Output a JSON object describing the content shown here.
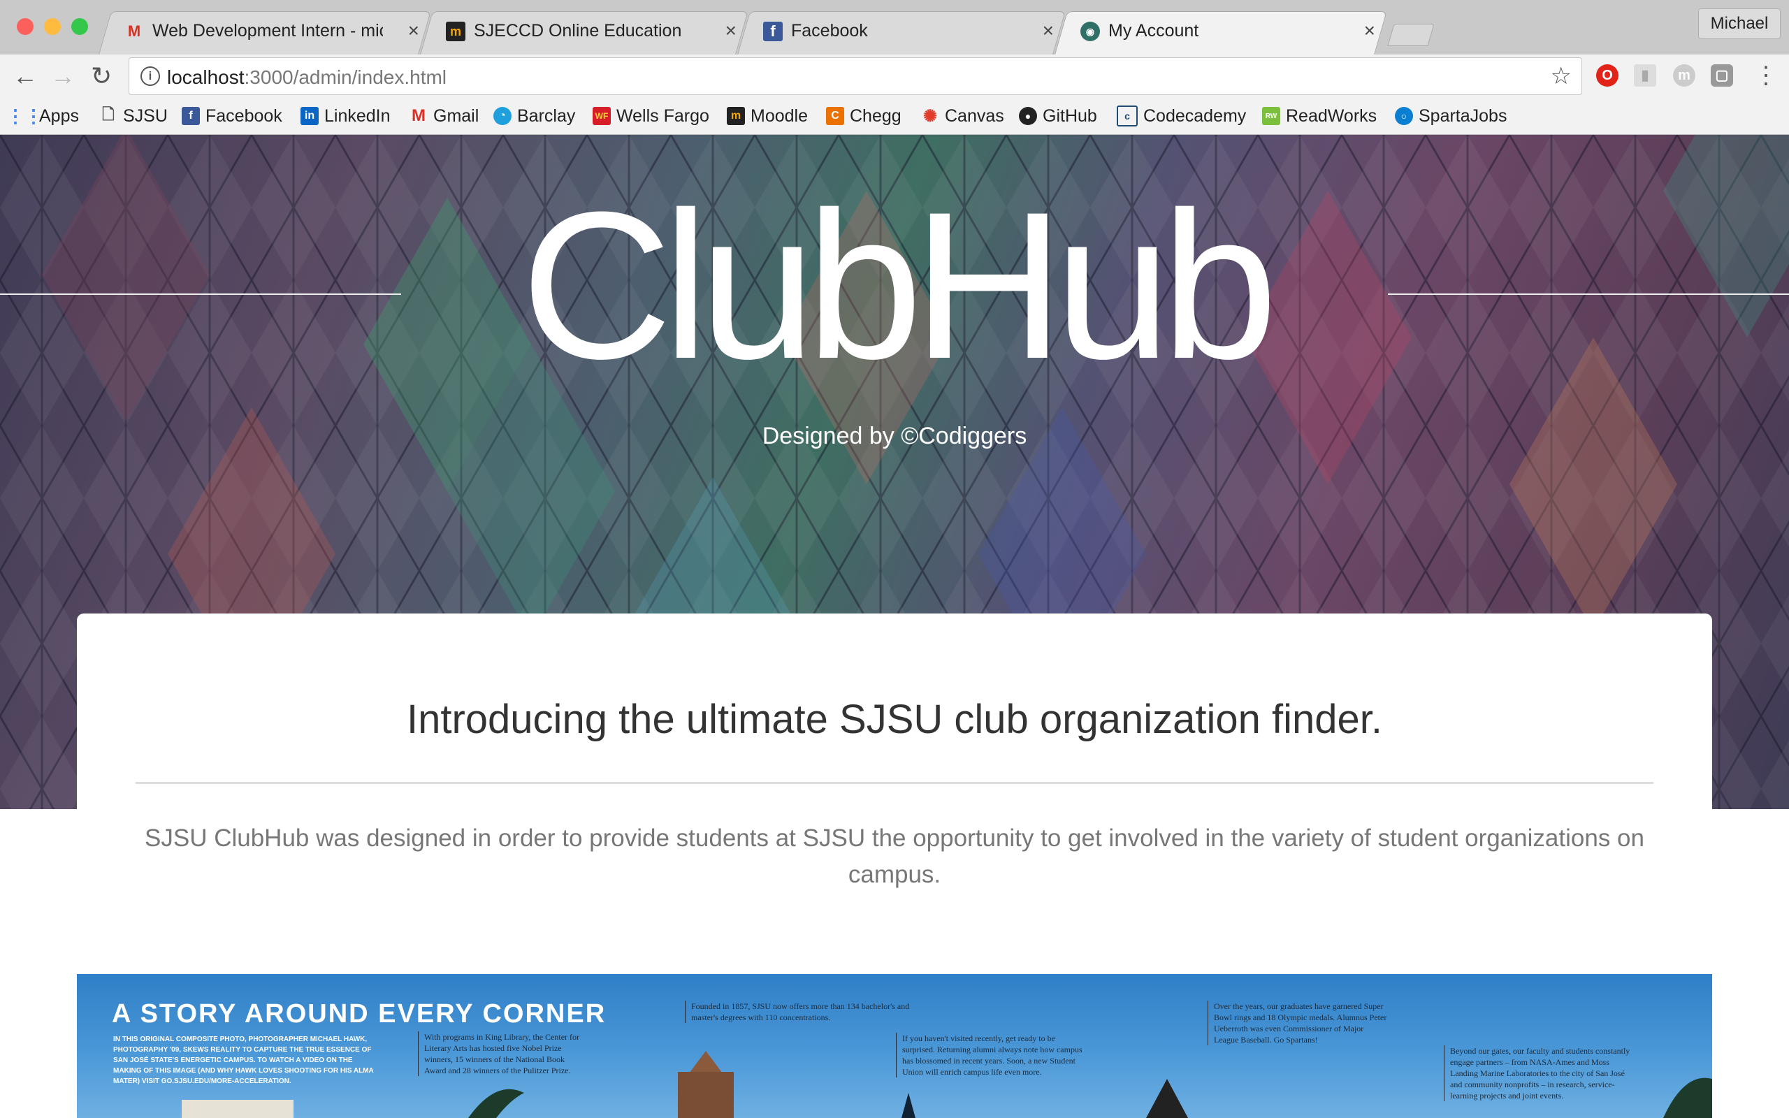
{
  "browser": {
    "tabs": [
      {
        "icon": "gmail-icon",
        "title": "Web Development Intern - mic"
      },
      {
        "icon": "moodle-icon",
        "title": "SJECCD Online Education"
      },
      {
        "icon": "facebook-icon",
        "title": "Facebook"
      },
      {
        "icon": "account-icon",
        "title": "My Account"
      }
    ],
    "profile": "Michael",
    "url_host": "localhost",
    "url_path": ":3000/admin/index.html"
  },
  "bookmarks": [
    {
      "icon": "apps-grid-icon",
      "label": "Apps"
    },
    {
      "icon": "page-icon",
      "label": "SJSU"
    },
    {
      "icon": "facebook-icon",
      "label": "Facebook"
    },
    {
      "icon": "linkedin-icon",
      "label": "LinkedIn"
    },
    {
      "icon": "gmail-icon",
      "label": "Gmail"
    },
    {
      "icon": "barclay-icon",
      "label": "Barclay"
    },
    {
      "icon": "wells-fargo-icon",
      "label": "Wells Fargo"
    },
    {
      "icon": "moodle-icon",
      "label": "Moodle"
    },
    {
      "icon": "chegg-icon",
      "label": "Chegg"
    },
    {
      "icon": "canvas-icon",
      "label": "Canvas"
    },
    {
      "icon": "github-icon",
      "label": "GitHub"
    },
    {
      "icon": "codecademy-icon",
      "label": "Codecademy"
    },
    {
      "icon": "readworks-icon",
      "label": "ReadWorks"
    },
    {
      "icon": "spartajobs-icon",
      "label": "SpartaJobs"
    }
  ],
  "hero": {
    "title": "ClubHub",
    "subtitle": "Designed by ©Codiggers"
  },
  "card": {
    "heading": "Introducing the ultimate SJSU club organization finder.",
    "description": "SJSU ClubHub was designed in order to provide students at SJSU the opportunity to get involved in the variety of student organizations on campus."
  },
  "poster": {
    "title": "A STORY AROUND EVERY CORNER",
    "caption": "IN THIS ORIGINAL COMPOSITE PHOTO, PHOTOGRAPHER MICHAEL HAWK, PHOTOGRAPHY '09, SKEWS REALITY TO CAPTURE THE TRUE ESSENCE OF SAN JOSÉ STATE'S ENERGETIC CAMPUS. TO WATCH A VIDEO ON THE MAKING OF THIS IMAGE (AND WHY HAWK LOVES SHOOTING FOR HIS ALMA MATER) VISIT GO.SJSU.EDU/MORE-ACCELERATION.",
    "col1": "With programs in King Library, the Center for Literary Arts has hosted five Nobel Prize winners, 15 winners of the National Book Award and 28 winners of the Pulitzer Prize.",
    "col2": "Founded in 1857, SJSU now offers more than 134 bachelor's and master's degrees with 110 concentrations.",
    "col3": "If you haven't visited recently, get ready to be surprised. Returning alumni always note how campus has blossomed in recent years. Soon, a new Student Union will enrich campus life even more.",
    "col4": "Over the years, our graduates have garnered Super Bowl rings and 18 Olympic medals. Alumnus Peter Ueberroth was even Commissioner of Major League Baseball. Go Spartans!",
    "col5": "Beyond our gates, our faculty and students constantly engage partners – from NASA-Ames and Moss Landing Marine Laboratories to the city of San José and community nonprofits – in research, service-learning projects and joint events."
  }
}
